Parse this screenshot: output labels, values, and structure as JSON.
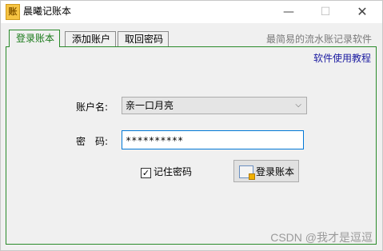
{
  "window": {
    "title": "晨曦记账本",
    "icon": "ledger-app-icon",
    "icon_glyph": "账",
    "controls": {
      "minimize": "—",
      "maximize": "☐",
      "close": "✕"
    }
  },
  "tabs": [
    {
      "label": "登录账本",
      "active": true
    },
    {
      "label": "添加账户",
      "active": false
    },
    {
      "label": "取回密码",
      "active": false
    }
  ],
  "tagline": "最简易的流水账记录软件",
  "help_link": "软件使用教程",
  "form": {
    "account_label": "账户名:",
    "account_value": "亲一口月亮",
    "password_label": "密　码:",
    "password_value": "**********",
    "remember_label": "记住密码",
    "remember_checked": true,
    "remember_mark": "✓",
    "login_button": "登录账本"
  },
  "watermark": "CSDN @我才是逗逗",
  "colors": {
    "accent_green": "#2a8a2a",
    "link_blue": "#1a1aa0",
    "focus_blue": "#0078d7"
  }
}
